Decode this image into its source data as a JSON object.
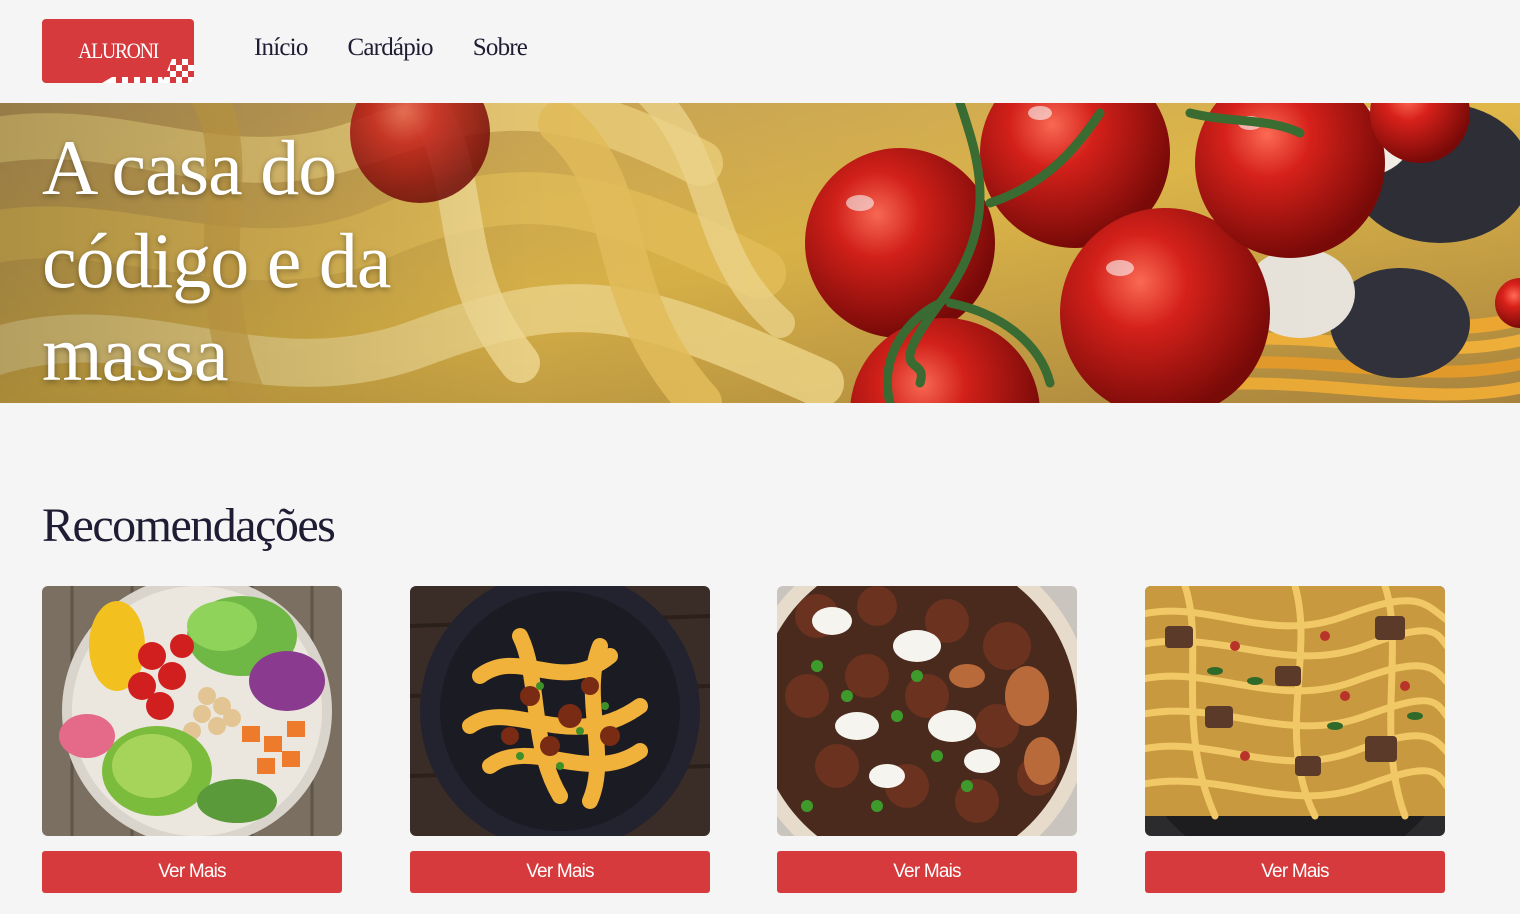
{
  "brand": {
    "logo_text": "ALURONI",
    "primary_color": "#d63a3c",
    "text_color": "#1f1d34",
    "background_color": "#f5f5f5"
  },
  "nav": {
    "items": [
      {
        "label": "Início"
      },
      {
        "label": "Cardápio"
      },
      {
        "label": "Sobre"
      }
    ]
  },
  "hero": {
    "title_lines": [
      "A casa do",
      "código e da",
      "massa"
    ]
  },
  "recommendations": {
    "title": "Recomendações",
    "cards": [
      {
        "image": "salad-bowl-photo",
        "button_label": "Ver Mais"
      },
      {
        "image": "bolognese-pasta-photo",
        "button_label": "Ver Mais"
      },
      {
        "image": "meatballs-dish-photo",
        "button_label": "Ver Mais"
      },
      {
        "image": "steak-fettuccine-photo",
        "button_label": "Ver Mais"
      }
    ]
  }
}
